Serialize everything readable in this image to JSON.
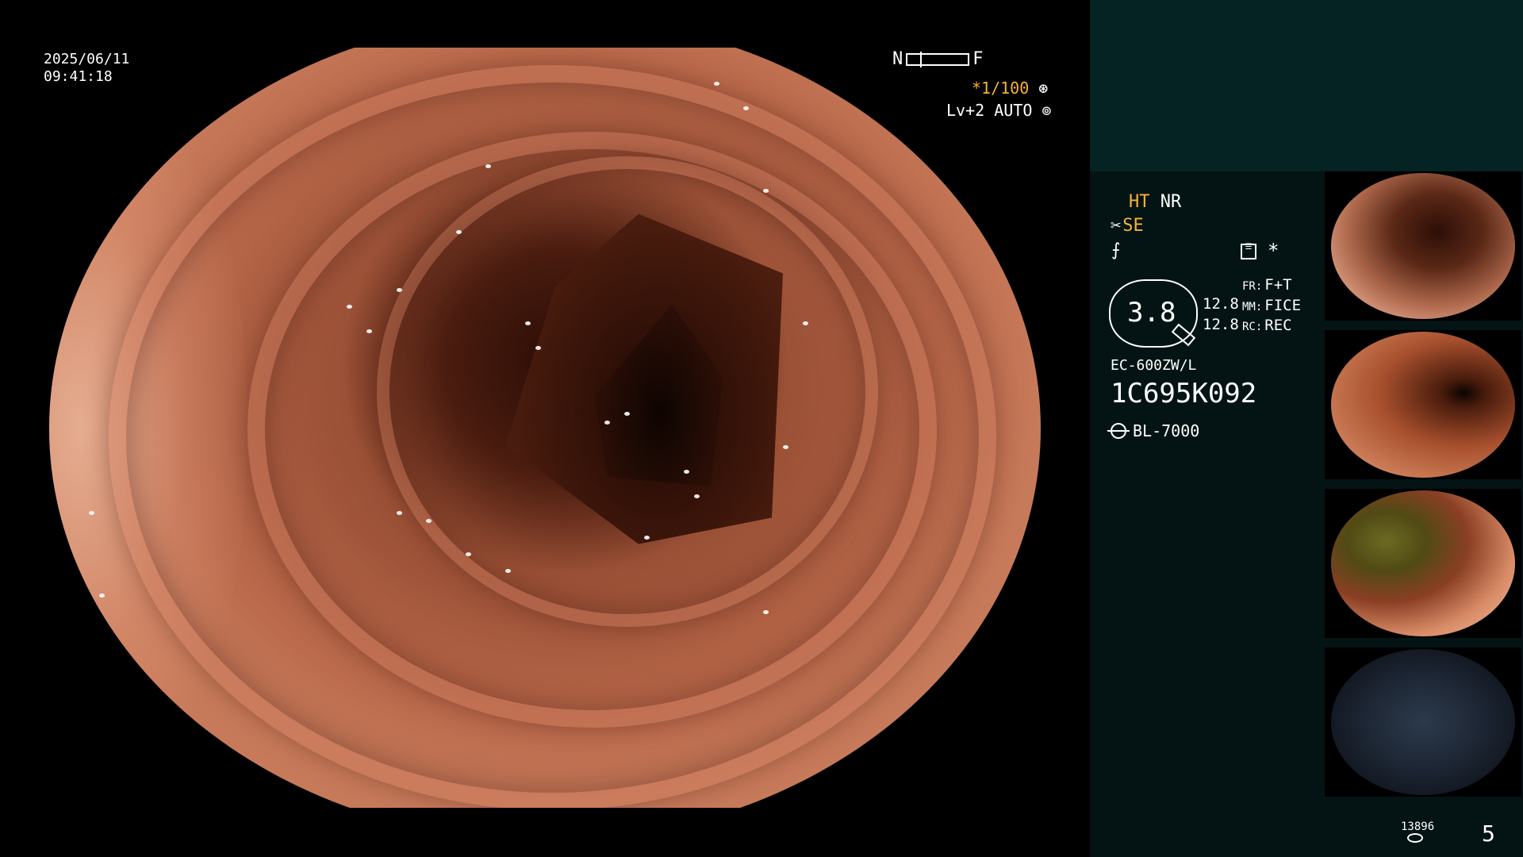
{
  "overlay": {
    "date": "2025/06/11",
    "time": "09:41:18",
    "near_label": "N",
    "far_label": "F",
    "shutter": "*1/100",
    "level": "Lv+2 AUTO"
  },
  "panel": {
    "ht": "HT",
    "nr": "NR",
    "se": "SE",
    "f_symbol": "⨍",
    "asterisk": "*",
    "zoom": "3.8",
    "value_a": "12.8",
    "value_b": "12.8",
    "fr_key": "FR:",
    "fr_value": "F+T",
    "mm_key": "MM:",
    "mm_value": "FICE",
    "rc_key": "RC:",
    "rc_value": "REC",
    "scope_model": "EC-600ZW/L",
    "serial": "1C695K092",
    "light_source": "BL-7000",
    "image_count": "13896",
    "page": "5"
  },
  "icons": {
    "shutter_icon": "aperture-icon",
    "level_icon": "iris-icon",
    "se_icon": "scissors-icon",
    "menu_icon": "menu-icon",
    "light_icon": "sun-icon",
    "storage_icon": "disk-icon"
  },
  "colors": {
    "accent": "#f5b23a",
    "panel_top": "#062323",
    "panel_body": "#041414"
  }
}
